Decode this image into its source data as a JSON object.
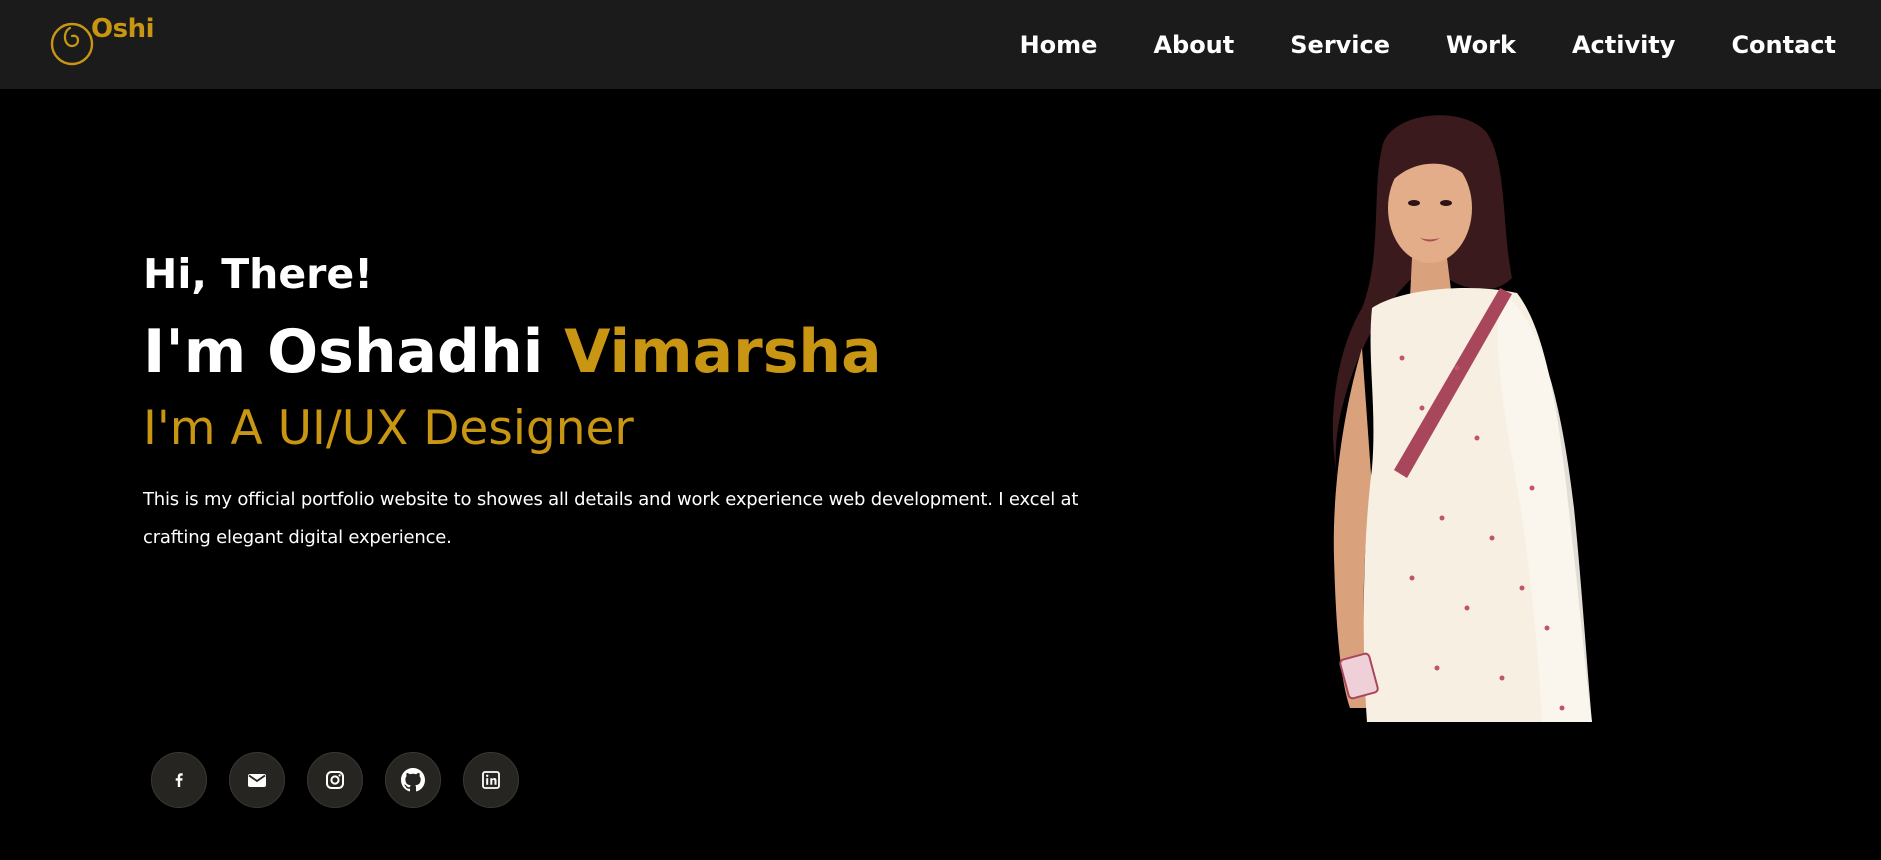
{
  "header": {
    "logo_text": "Oshi",
    "nav": [
      {
        "label": "Home"
      },
      {
        "label": "About"
      },
      {
        "label": "Service"
      },
      {
        "label": "Work"
      },
      {
        "label": "Activity"
      },
      {
        "label": "Contact"
      }
    ]
  },
  "hero": {
    "greeting": "Hi, There!",
    "name_prefix": "I'm Oshadhi",
    "name_highlight": "Vimarsha",
    "role": "I'm A UI/UX Designer",
    "bio": "This is my official portfolio website to showes all details and work experience web development. I excel at crafting elegant digital experience."
  },
  "social": [
    {
      "icon": "facebook-icon"
    },
    {
      "icon": "email-icon"
    },
    {
      "icon": "instagram-icon"
    },
    {
      "icon": "github-icon"
    },
    {
      "icon": "linkedin-icon"
    }
  ],
  "colors": {
    "accent": "#c99613",
    "nav_background": "#1b1b1b",
    "page_background": "#000000",
    "social_button_bg": "#262521"
  }
}
